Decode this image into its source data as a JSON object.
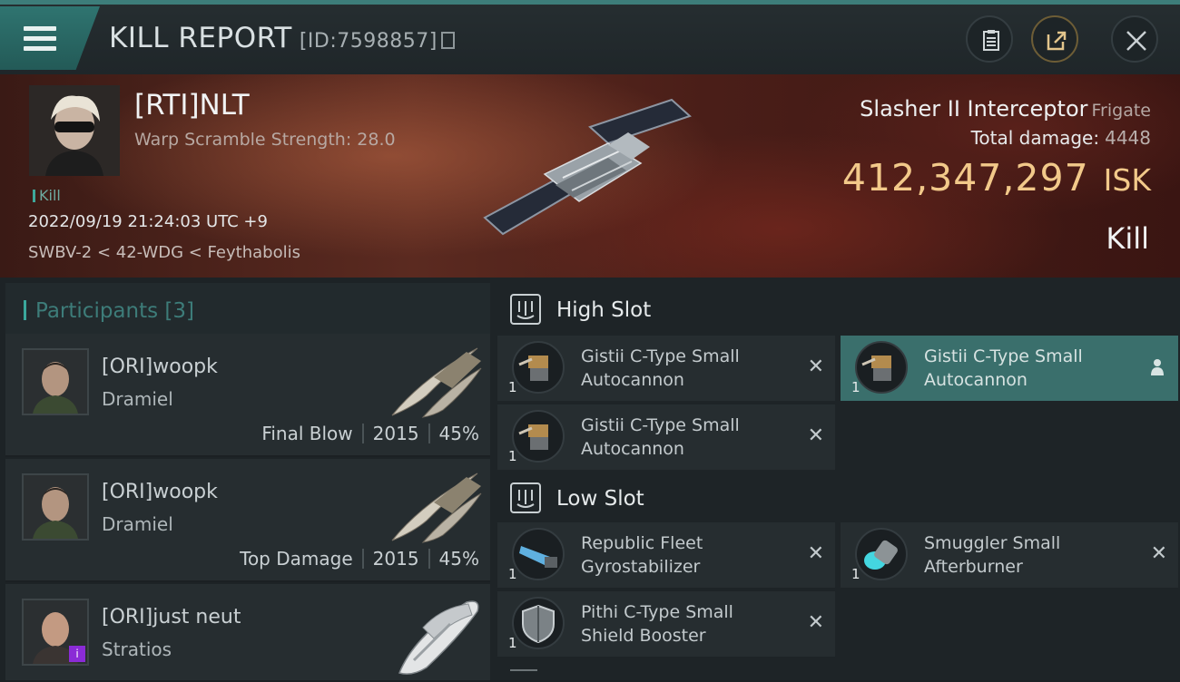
{
  "header": {
    "title": "KILL REPORT",
    "report_id": "[ID:7598857]"
  },
  "victim": {
    "name": "[RTI]NLT",
    "warp_scramble": "Warp Scramble Strength: 28.0",
    "kill_tag": "Kill",
    "datetime": "2022/09/19 21:24:03 UTC +9",
    "location": "SWBV-2 < 42-WDG < Feythabolis",
    "ship_name": "Slasher II Interceptor",
    "ship_class": "Frigate",
    "total_damage_label": "Total damage:",
    "total_damage": "4448",
    "isk_value": "412,347,297",
    "isk_label": "ISK",
    "result": "Kill"
  },
  "participants": {
    "label": "Participants [3]",
    "rows": [
      {
        "name": "[ORI]woopk",
        "ship": "Dramiel",
        "role": "Final Blow",
        "damage": "2015",
        "percent": "45%"
      },
      {
        "name": "[ORI]woopk",
        "ship": "Dramiel",
        "role": "Top Damage",
        "damage": "2015",
        "percent": "45%"
      },
      {
        "name": "[ORI]just neut",
        "ship": "Stratios",
        "badge": "i"
      }
    ]
  },
  "fitting": {
    "high_slot_label": "High Slot",
    "low_slot_label": "Low Slot",
    "high_modules": [
      {
        "name_line1": "Gistii C-Type Small",
        "name_line2": "Autocannon",
        "qty": "1",
        "mark": "✕"
      },
      {
        "name_line1": "Gistii C-Type Small",
        "name_line2": "Autocannon",
        "qty": "1"
      },
      {
        "name_line1": "Gistii C-Type Small",
        "name_line2": "Autocannon",
        "qty": "1",
        "mark": "✕"
      }
    ],
    "low_modules": [
      {
        "name_line1": "Republic Fleet",
        "name_line2": "Gyrostabilizer",
        "qty": "1",
        "mark": "✕"
      },
      {
        "name_line1": "Smuggler Small",
        "name_line2": "Afterburner",
        "qty": "1",
        "mark": "✕"
      },
      {
        "name_line1": "Pithi C-Type Small",
        "name_line2": "Shield Booster",
        "qty": "1",
        "mark": "✕"
      }
    ]
  },
  "colors": {
    "accent_teal": "#3d7d7a",
    "isk_gold": "#f2c98a",
    "selected_module": "#3a6f6c"
  },
  "icons": [
    "menu-icon",
    "copy-icon",
    "clipboard-icon",
    "share-icon",
    "close-icon",
    "high-slot-icon",
    "low-slot-icon",
    "pilot-icon"
  ]
}
